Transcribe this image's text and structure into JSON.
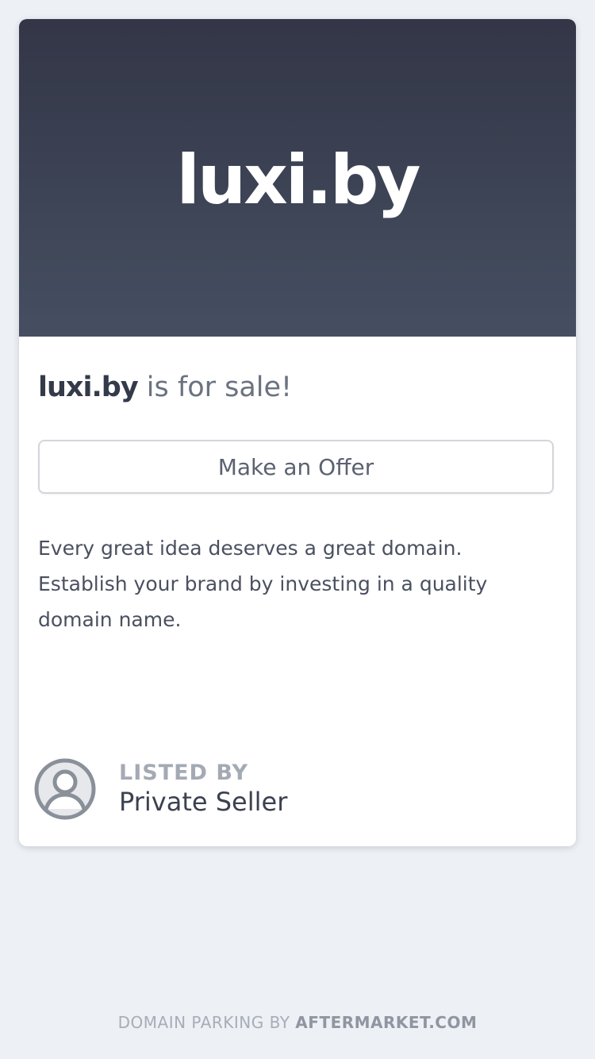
{
  "hero": {
    "domain": "luxi.by"
  },
  "sale": {
    "domain": "luxi.by",
    "suffix": " is for sale!"
  },
  "offer_button": {
    "label": "Make an Offer"
  },
  "description": "Every great idea deserves a great domain. Establish your brand by investing in a quality domain name.",
  "seller": {
    "label": "LISTED BY",
    "name": "Private Seller",
    "icon": "user-avatar-icon"
  },
  "footer": {
    "prefix": "DOMAIN PARKING BY ",
    "brand": "AFTERMARKET.COM"
  },
  "colors": {
    "page_background": "#edf0f4",
    "hero_gradient_top": "#333647",
    "hero_gradient_bottom": "#454f61",
    "card_background": "#ffffff",
    "heading_dark": "#333a4a",
    "muted_text": "#a4aab4"
  }
}
